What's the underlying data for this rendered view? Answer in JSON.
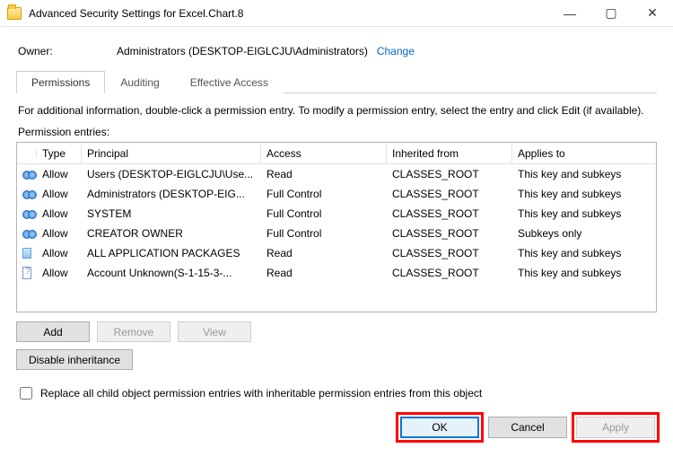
{
  "window": {
    "title": "Advanced Security Settings for Excel.Chart.8"
  },
  "owner": {
    "label": "Owner:",
    "value": "Administrators (DESKTOP-EIGLCJU\\Administrators)",
    "change": "Change"
  },
  "tabs": [
    {
      "label": "Permissions",
      "active": true
    },
    {
      "label": "Auditing",
      "active": false
    },
    {
      "label": "Effective Access",
      "active": false
    }
  ],
  "infoline": "For additional information, double-click a permission entry. To modify a permission entry, select the entry and click Edit (if available).",
  "entries_label": "Permission entries:",
  "grid": {
    "headers": {
      "type": "Type",
      "principal": "Principal",
      "access": "Access",
      "inherited": "Inherited from",
      "applies": "Applies to"
    },
    "rows": [
      {
        "icon": "people",
        "type": "Allow",
        "principal": "Users (DESKTOP-EIGLCJU\\Use...",
        "access": "Read",
        "inherited": "CLASSES_ROOT",
        "applies": "This key and subkeys"
      },
      {
        "icon": "people",
        "type": "Allow",
        "principal": "Administrators (DESKTOP-EIG...",
        "access": "Full Control",
        "inherited": "CLASSES_ROOT",
        "applies": "This key and subkeys"
      },
      {
        "icon": "people",
        "type": "Allow",
        "principal": "SYSTEM",
        "access": "Full Control",
        "inherited": "CLASSES_ROOT",
        "applies": "This key and subkeys"
      },
      {
        "icon": "people",
        "type": "Allow",
        "principal": "CREATOR OWNER",
        "access": "Full Control",
        "inherited": "CLASSES_ROOT",
        "applies": "Subkeys only"
      },
      {
        "icon": "package",
        "type": "Allow",
        "principal": "ALL APPLICATION PACKAGES",
        "access": "Read",
        "inherited": "CLASSES_ROOT",
        "applies": "This key and subkeys"
      },
      {
        "icon": "unknown",
        "type": "Allow",
        "principal": "Account Unknown(S-1-15-3-...",
        "access": "Read",
        "inherited": "CLASSES_ROOT",
        "applies": "This key and subkeys"
      }
    ]
  },
  "buttons": {
    "add": "Add",
    "remove": "Remove",
    "view": "View",
    "disable_inherit": "Disable inheritance",
    "replace_label": "Replace all child object permission entries with inheritable permission entries from this object",
    "ok": "OK",
    "cancel": "Cancel",
    "apply": "Apply"
  }
}
